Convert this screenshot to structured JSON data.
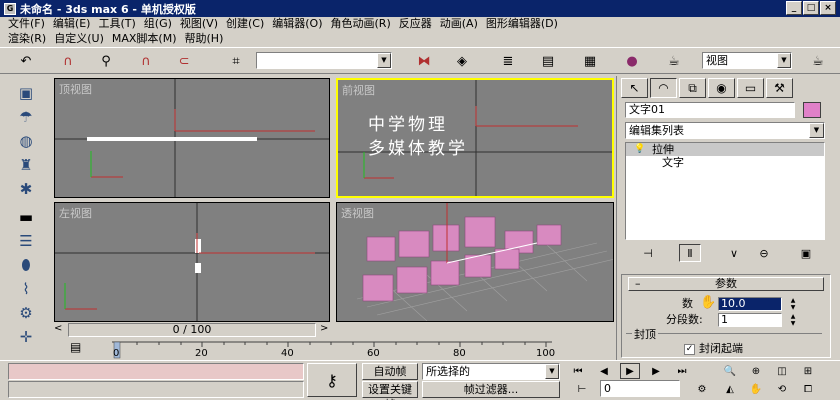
{
  "window": {
    "title": "未命名 - 3ds max 6 - 单机授权版"
  },
  "menus": [
    {
      "label": "文件(F)"
    },
    {
      "label": "编辑(E)"
    },
    {
      "label": "工具(T)"
    },
    {
      "label": "组(G)"
    },
    {
      "label": "视图(V)"
    },
    {
      "label": "创建(C)"
    },
    {
      "label": "编辑器(O)"
    },
    {
      "label": "角色动画(R)"
    },
    {
      "label": "反应器"
    },
    {
      "label": "动画(A)"
    },
    {
      "label": "图形编辑器(D)"
    },
    {
      "label": "渲染(R)"
    },
    {
      "label": "自定义(U)"
    },
    {
      "label": "MAX脚本(M)"
    },
    {
      "label": "帮助(H)"
    }
  ],
  "toolbar": {
    "selection_set_value": "",
    "view_dropdown_value": "视图"
  },
  "viewports": {
    "top": {
      "label": "顶视图"
    },
    "front": {
      "label": "前视图",
      "text_line1": "中学物理",
      "text_line2": "多媒体教学"
    },
    "left": {
      "label": "左视图"
    },
    "perspective": {
      "label": "透视图"
    }
  },
  "timeline": {
    "frame_slider": "0 / 100"
  },
  "ruler": {
    "ticks": [
      "0",
      "20",
      "40",
      "60",
      "80",
      "100"
    ]
  },
  "command_panel": {
    "object_name": "文字01",
    "object_color": "#e080c8",
    "modifier_list": "编辑集列表",
    "stack": [
      {
        "label": "拉伸"
      },
      {
        "label": "文字"
      }
    ],
    "rollout_title": "参数",
    "amount_label": "数",
    "amount_value": "10.0",
    "segments_label": "分段数:",
    "segments_value": "1",
    "capping_label": "封顶",
    "cap_start_label": "封闭起端"
  },
  "statusbar": {
    "auto_key": "自动帧",
    "set_key": "设置关键帧",
    "selected_dropdown": "所选择的",
    "key_filters": "帧过滤器...",
    "current_frame": "0"
  }
}
